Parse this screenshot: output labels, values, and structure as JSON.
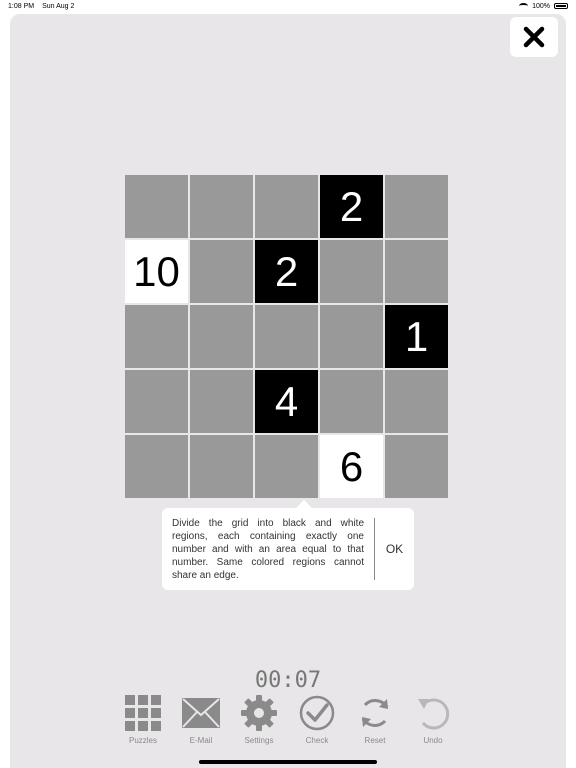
{
  "status_bar": {
    "time": "1:08 PM",
    "date": "Sun Aug 2",
    "battery": "100%"
  },
  "close_button": {
    "icon": "close-icon"
  },
  "grid": {
    "rows": [
      [
        {
          "state": "gray",
          "number": ""
        },
        {
          "state": "gray",
          "number": ""
        },
        {
          "state": "gray",
          "number": ""
        },
        {
          "state": "black",
          "number": "2"
        },
        {
          "state": "gray",
          "number": ""
        }
      ],
      [
        {
          "state": "white",
          "number": "10"
        },
        {
          "state": "gray",
          "number": ""
        },
        {
          "state": "black",
          "number": "2"
        },
        {
          "state": "gray",
          "number": ""
        },
        {
          "state": "gray",
          "number": ""
        }
      ],
      [
        {
          "state": "gray",
          "number": ""
        },
        {
          "state": "gray",
          "number": ""
        },
        {
          "state": "gray",
          "number": ""
        },
        {
          "state": "gray",
          "number": ""
        },
        {
          "state": "black",
          "number": "1"
        }
      ],
      [
        {
          "state": "gray",
          "number": ""
        },
        {
          "state": "gray",
          "number": ""
        },
        {
          "state": "black",
          "number": "4"
        },
        {
          "state": "gray",
          "number": ""
        },
        {
          "state": "gray",
          "number": ""
        }
      ],
      [
        {
          "state": "gray",
          "number": ""
        },
        {
          "state": "gray",
          "number": ""
        },
        {
          "state": "gray",
          "number": ""
        },
        {
          "state": "white",
          "number": "6"
        },
        {
          "state": "gray",
          "number": ""
        }
      ]
    ]
  },
  "tooltip": {
    "text": "Divide the grid into black and white regions, each containing exactly one number and with an area equal to that number. Same colored regions cannot share an edge.",
    "ok_label": "OK"
  },
  "timer": "00:07",
  "toolbar": {
    "items": [
      {
        "label": "Puzzles",
        "icon": "grid-icon"
      },
      {
        "label": "E-Mail",
        "icon": "envelope-icon"
      },
      {
        "label": "Settings",
        "icon": "gear-icon"
      },
      {
        "label": "Check",
        "icon": "check-icon"
      },
      {
        "label": "Reset",
        "icon": "reset-icon"
      },
      {
        "label": "Undo",
        "icon": "undo-icon"
      }
    ]
  },
  "colors": {
    "background": "#e8e6e8",
    "cell_gray": "#999999",
    "cell_black": "#000000",
    "cell_white": "#ffffff",
    "icon_gray": "#8a8a8a"
  }
}
